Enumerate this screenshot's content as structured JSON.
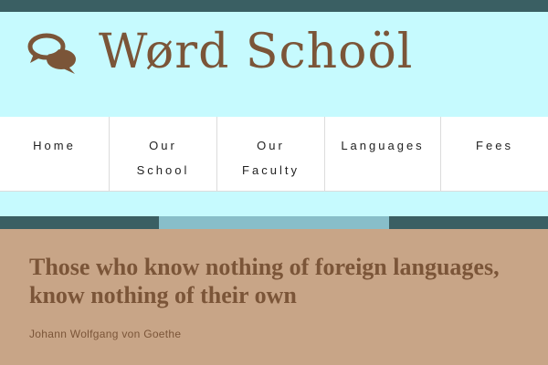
{
  "site": {
    "title": "Wørd Schoöl"
  },
  "nav": {
    "items": [
      {
        "label": "Home"
      },
      {
        "label": "Our School"
      },
      {
        "label": "Our Faculty"
      },
      {
        "label": "Languages"
      },
      {
        "label": "Fees"
      }
    ]
  },
  "quote": {
    "text": "Those who know nothing of foreign languages, know nothing of their own",
    "author": "Johann Wolfgang von Goethe"
  },
  "colors": {
    "topbar": "#3a5f63",
    "header_bg": "#c6fafe",
    "brand_brown": "#7b5538",
    "divider_accent": "#88bec9",
    "quote_bg": "#c8a587"
  },
  "icons": {
    "logo": "speech-bubbles-icon"
  }
}
